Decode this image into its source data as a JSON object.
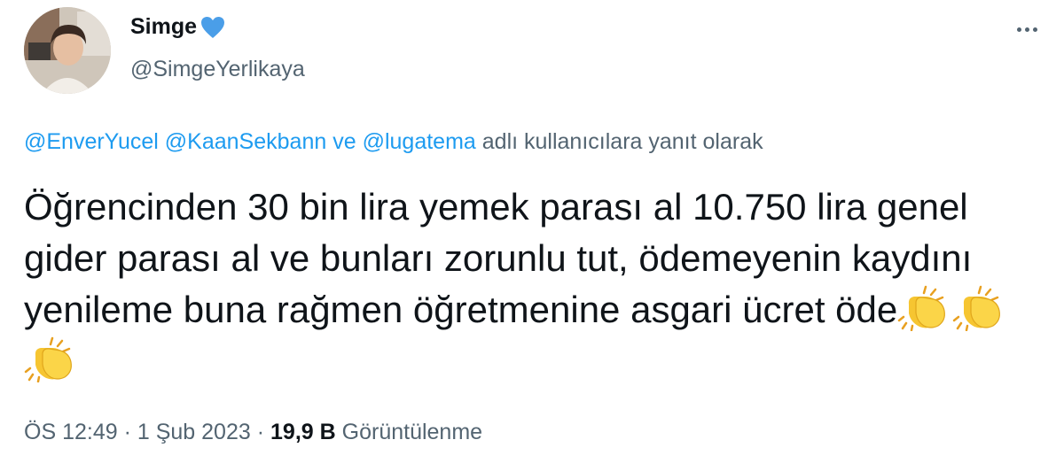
{
  "author": {
    "display_name": "Simge",
    "handle": "@SimgeYerlikaya",
    "verified_heart_color": "#4a9ee8",
    "avatar_icon": "profile-photo"
  },
  "reply_context": {
    "mentions": [
      "@EnverYucel",
      "@KaanSekbann"
    ],
    "connector": "ve",
    "last_mention": "@lugatema",
    "suffix": "adlı kullanıcılara yanıt olarak"
  },
  "tweet": {
    "text": "Öğrencinden 30 bin lira yemek parası al 10.750 lira genel gider parası al ve bunları zorunlu tut, ödemeyenin kaydını yenileme buna rağmen öğretmenine asgari ücret öde",
    "emojis": [
      "clapping-hands-icon",
      "clapping-hands-icon",
      "clapping-hands-icon"
    ]
  },
  "meta": {
    "time": "ÖS 12:49",
    "separator": "·",
    "date": "1 Şub 2023",
    "views_count": "19,9 B",
    "views_label": "Görüntülenme"
  },
  "colors": {
    "link": "#1d9bf0",
    "secondary_text": "#536471",
    "primary_text": "#0f1419",
    "emoji_yellow": "#f6c531"
  }
}
